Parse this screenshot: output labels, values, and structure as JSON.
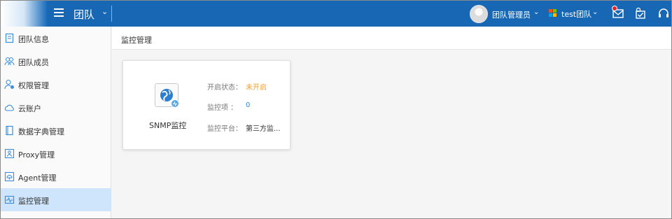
{
  "topbar": {
    "team_title": "团队",
    "user_name": "团队管理员",
    "org_name": "test团队",
    "colors": {
      "bar": "#1767b5",
      "notify": "#e6232e"
    },
    "icons": [
      "menu-icon",
      "chevron-down-icon",
      "avatar",
      "microsoft-icon",
      "mail-icon",
      "task-check-icon",
      "headset-icon"
    ]
  },
  "sidebar": {
    "items": [
      {
        "label": "团队信息",
        "icon": "document-icon"
      },
      {
        "label": "团队成员",
        "icon": "users-icon"
      },
      {
        "label": "权限管理",
        "icon": "user-key-icon"
      },
      {
        "label": "云账户",
        "icon": "cloud-icon"
      },
      {
        "label": "数据字典管理",
        "icon": "book-icon"
      },
      {
        "label": "Proxy管理",
        "icon": "proxy-icon"
      },
      {
        "label": "Agent管理",
        "icon": "agent-icon"
      },
      {
        "label": "监控管理",
        "icon": "monitor-icon"
      }
    ],
    "active_index": 7,
    "active_color": "#cfe5fb"
  },
  "main": {
    "breadcrumb": "监控管理",
    "card": {
      "name": "SNMP监控",
      "icon": "globe-icon",
      "rows": [
        {
          "key": "开启状态：",
          "value": "未开启",
          "color": "#f0a22e"
        },
        {
          "key": "监控项 ：",
          "value": "0",
          "color": "#2f8ae0"
        },
        {
          "key": "监控平台：",
          "value": "第三方监...",
          "color": "#333333"
        }
      ]
    }
  }
}
